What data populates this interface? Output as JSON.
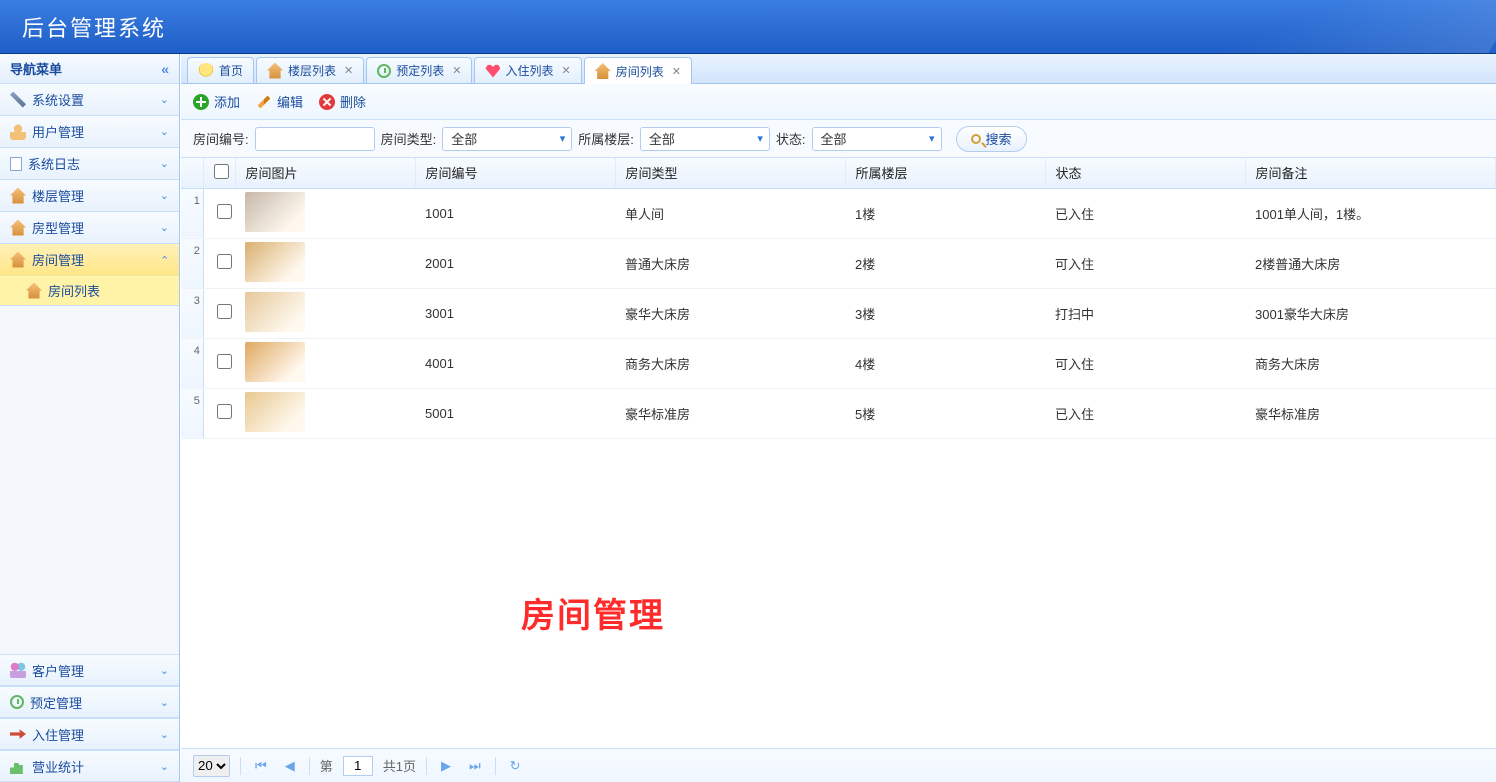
{
  "header": {
    "title": "后台管理系统"
  },
  "nav": {
    "title": "导航菜单",
    "items_top": [
      {
        "label": "系统设置",
        "icon": "wrench-icon"
      },
      {
        "label": "用户管理",
        "icon": "user-icon"
      },
      {
        "label": "系统日志",
        "icon": "doc-icon"
      },
      {
        "label": "楼层管理",
        "icon": "house-icon"
      },
      {
        "label": "房型管理",
        "icon": "house-icon"
      },
      {
        "label": "房间管理",
        "icon": "house-icon",
        "expanded": true,
        "children": [
          {
            "label": "房间列表",
            "icon": "house-icon",
            "active": true
          }
        ]
      }
    ],
    "items_bottom": [
      {
        "label": "客户管理",
        "icon": "people-icon"
      },
      {
        "label": "预定管理",
        "icon": "clock-icon"
      },
      {
        "label": "入住管理",
        "icon": "arrow-in-icon"
      },
      {
        "label": "营业统计",
        "icon": "stat-icon"
      }
    ]
  },
  "tabs": [
    {
      "label": "首页",
      "icon": "bulb-icon",
      "closable": false
    },
    {
      "label": "楼层列表",
      "icon": "house-icon",
      "closable": true
    },
    {
      "label": "预定列表",
      "icon": "clock-icon",
      "closable": true
    },
    {
      "label": "入住列表",
      "icon": "heart-icon",
      "closable": true
    },
    {
      "label": "房间列表",
      "icon": "house-icon",
      "closable": true,
      "active": true
    }
  ],
  "toolbar": {
    "add": "添加",
    "edit": "编辑",
    "delete": "删除"
  },
  "filters": {
    "room_no_label": "房间编号:",
    "room_no_value": "",
    "room_type_label": "房间类型:",
    "room_type_value": "全部",
    "floor_label": "所属楼层:",
    "floor_value": "全部",
    "status_label": "状态:",
    "status_value": "全部",
    "search_label": "搜索"
  },
  "columns": [
    "房间图片",
    "房间编号",
    "房间类型",
    "所属楼层",
    "状态",
    "房间备注"
  ],
  "rows": [
    {
      "img": "#c6b8aa",
      "no": "1001",
      "type": "单人间",
      "floor": "1楼",
      "status": "已入住",
      "remark": "1001单人间，1楼。"
    },
    {
      "img": "#d8b070",
      "no": "2001",
      "type": "普通大床房",
      "floor": "2楼",
      "status": "可入住",
      "remark": "2楼普通大床房"
    },
    {
      "img": "#e6c89a",
      "no": "3001",
      "type": "豪华大床房",
      "floor": "3楼",
      "status": "打扫中",
      "remark": "3001豪华大床房"
    },
    {
      "img": "#e0a860",
      "no": "4001",
      "type": "商务大床房",
      "floor": "4楼",
      "status": "可入住",
      "remark": "商务大床房"
    },
    {
      "img": "#e8c890",
      "no": "5001",
      "type": "豪华标准房",
      "floor": "5楼",
      "status": "已入住",
      "remark": "豪华标准房"
    }
  ],
  "watermark": "房间管理",
  "pager": {
    "page_size": "20",
    "prefix": "第",
    "current": "1",
    "suffix": "共1页"
  }
}
